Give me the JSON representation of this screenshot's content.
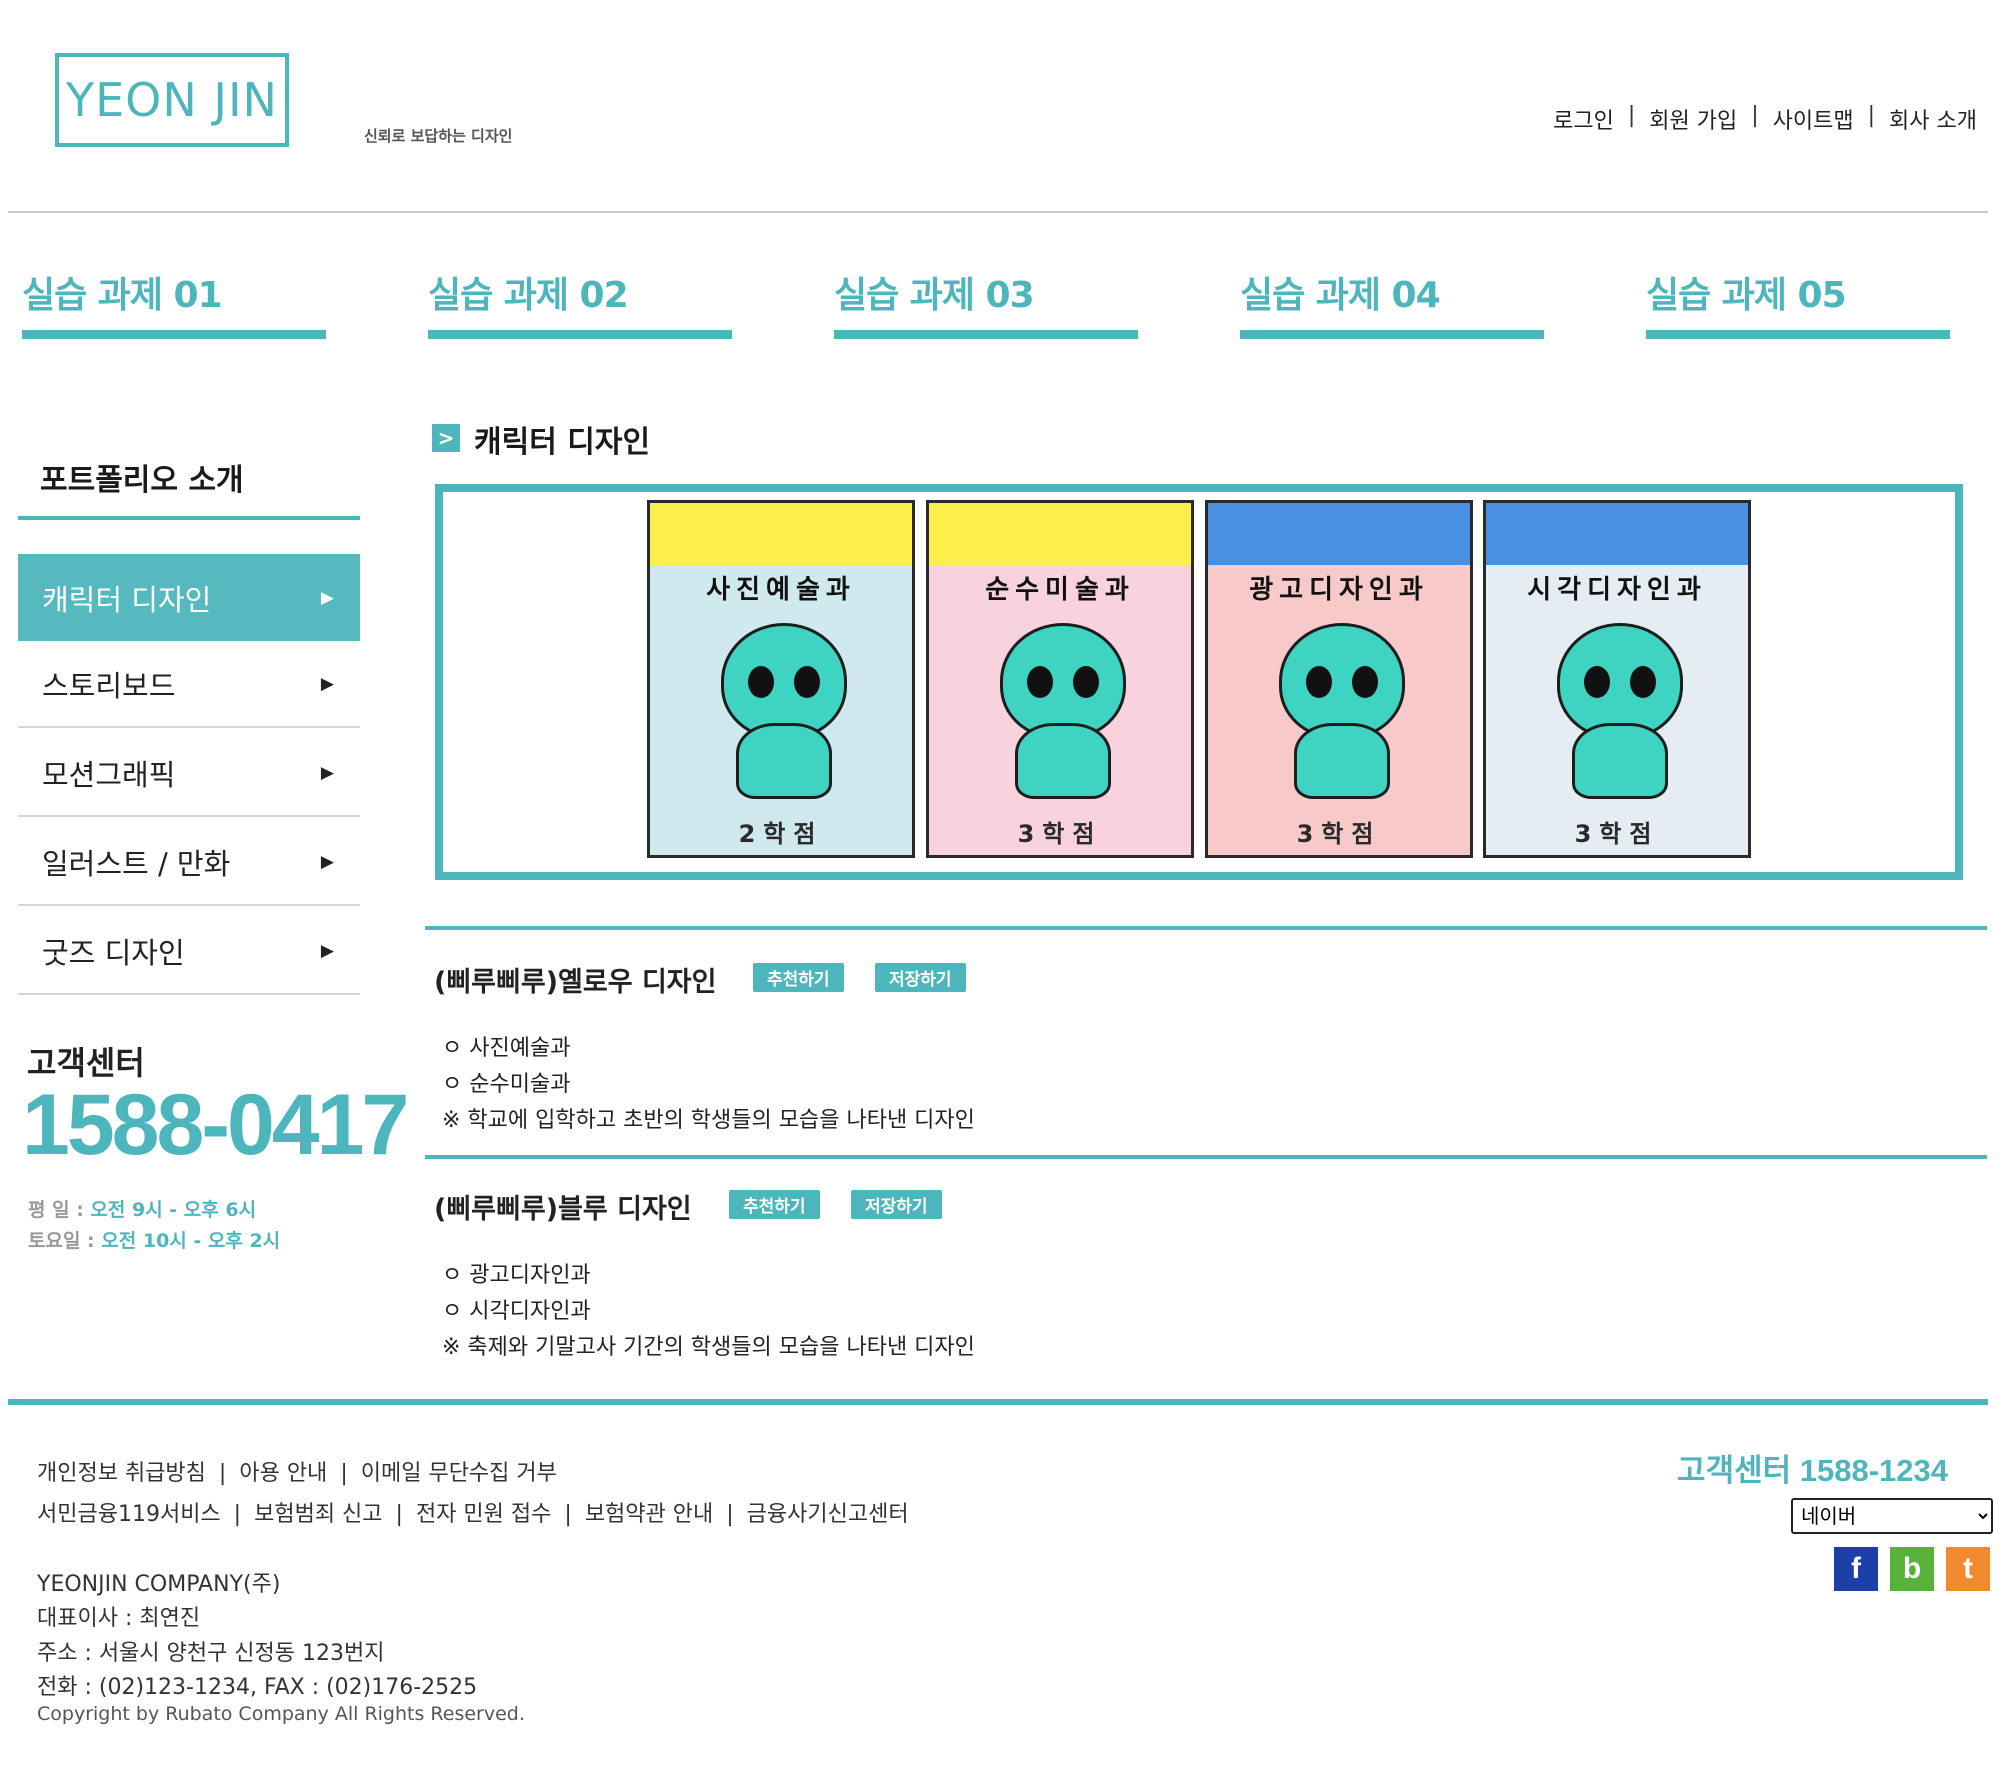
{
  "header": {
    "logo": "YEON JIN",
    "tagline": "신뢰로 보답하는 디자인",
    "links": [
      "로그인",
      "회원 가입",
      "사이트맵",
      "회사 소개"
    ]
  },
  "nav": {
    "tabs": [
      "실습 과제 01",
      "실습 과제 02",
      "실습 과제 03",
      "실습 과제 04",
      "실습 과제 05"
    ]
  },
  "sidebar": {
    "title": "포트폴리오 소개",
    "items": [
      {
        "label": "캐릭터 디자인",
        "active": true
      },
      {
        "label": "스토리보드",
        "active": false
      },
      {
        "label": "모션그래픽",
        "active": false
      },
      {
        "label": "일러스트 / 만화",
        "active": false
      },
      {
        "label": "굿즈 디자인",
        "active": false
      }
    ],
    "arrow": "▶",
    "customer_center": {
      "title": "고객센터",
      "phone": "1588-0417",
      "weekday_label": "평  일 :",
      "weekday_hours": "오전 9시 - 오후 6시",
      "saturday_label": "토요일 :",
      "saturday_hours": "오전 10시 - 오후 2시"
    }
  },
  "main": {
    "section_icon": ">",
    "section_title": "캐릭터 디자인",
    "cards": [
      {
        "dept": "사진예술과",
        "grade": "2학점",
        "band_color": "#fdef4a",
        "art_color": "#cfe9ef"
      },
      {
        "dept": "순수미술과",
        "grade": "3학점",
        "band_color": "#fdef4a",
        "art_color": "#f8d2dc"
      },
      {
        "dept": "광고디자인과",
        "grade": "3학점",
        "band_color": "#4a90e2",
        "art_color": "#f7c9c9"
      },
      {
        "dept": "시각디자인과",
        "grade": "3학점",
        "band_color": "#4a90e2",
        "art_color": "#e4eef2"
      }
    ],
    "posts": [
      {
        "title": "(삐루삐루)옐로우 디자인",
        "recommend": "추천하기",
        "save": "저장하기",
        "lines": [
          "ㅇ 사진예술과",
          "ㅇ 순수미술과",
          "※ 학교에 입학하고 초반의 학생들의 모습을 나타낸 디자인"
        ]
      },
      {
        "title": "(삐루삐루)블루 디자인",
        "recommend": "추천하기",
        "save": "저장하기",
        "lines": [
          "ㅇ 광고디자인과",
          "ㅇ 시각디자인과",
          "※ 축제와 기말고사 기간의 학생들의 모습을 나타낸 디자인"
        ]
      }
    ]
  },
  "footer": {
    "links_row1": [
      "개인정보 취급방침",
      "아용 안내",
      "이메일 무단수집 거부"
    ],
    "links_row2": [
      "서민금융119서비스",
      "보험범죄 신고",
      "전자 민원 접수",
      "보험약관 안내",
      "금융사기신고센터"
    ],
    "company": "YEONJIN COMPANY(주)",
    "ceo": "대표이사 : 최연진",
    "address": "주소 : 서울시 양천구 신정동 123번지",
    "contact": "전화 : (02)123-1234, FAX : (02)176-2525",
    "copyright": "Copyright by Rubato Company All Rights Reserved.",
    "customer_center": "고객센터 1588-1234",
    "select_value": "네이버",
    "social": [
      {
        "icon": "facebook-icon",
        "glyph": "f",
        "color": "#1d3fa8"
      },
      {
        "icon": "blog-icon",
        "glyph": "b",
        "color": "#57b23a"
      },
      {
        "icon": "twitter-icon",
        "glyph": "t",
        "color": "#f08a2c"
      }
    ]
  }
}
